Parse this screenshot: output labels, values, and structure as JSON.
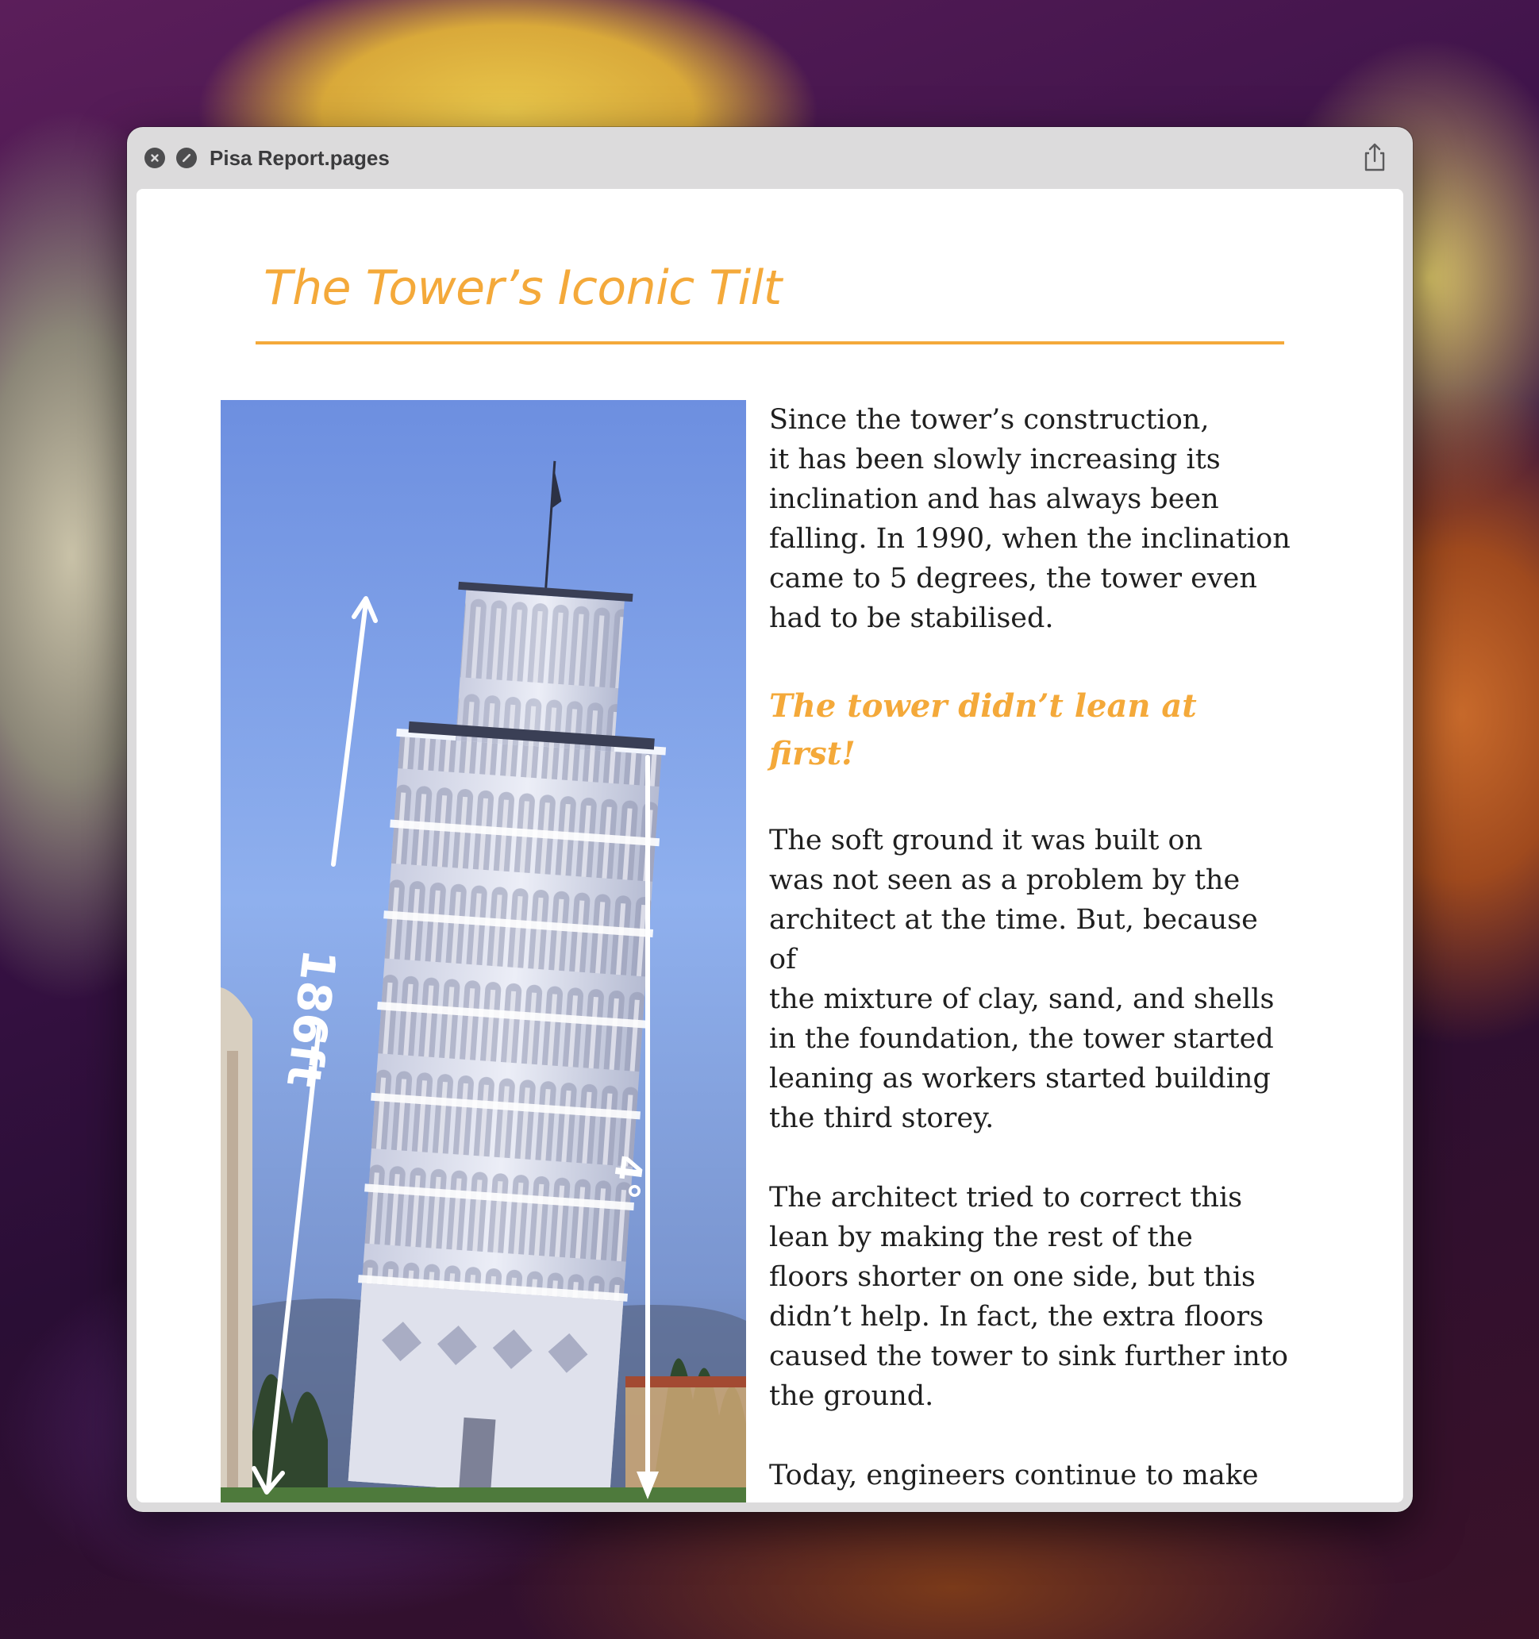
{
  "window": {
    "title": "Pisa Report.pages"
  },
  "document": {
    "heading": "The Tower’s Iconic Tilt",
    "paragraphs": {
      "p1": "Since the tower’s construction,\nit has been slowly increasing its\ninclination and has always been\nfalling. In 1990, when the inclination\ncame to 5 degrees, the tower even\nhad to be stabilised.",
      "subheading": "The tower didn’t lean at first!",
      "p2": "The soft ground it was built on\nwas not seen as a problem by the\narchitect at the time. But, because of\nthe mixture of clay, sand, and shells\nin the foundation, the tower started\nleaning as workers started building\nthe third storey.",
      "p3": "The architect tried to correct this\nlean by making the rest of the\nfloors shorter on one side, but this\ndidn’t help. In fact, the extra floors\ncaused the tower to sink further into\nthe ground.",
      "p4": "Today, engineers continue to make\nsure the centre of gravity still falls\ninside the base. As long as that\nremains true, the tower won’t fall."
    },
    "photo_annotations": {
      "height_label": "186ft",
      "angle_label": "4°"
    }
  },
  "icons": {
    "close": "close-icon",
    "fullscreen": "fullscreen-icon",
    "share": "share-icon"
  },
  "colors": {
    "accent": "#f4a93a",
    "body_text": "#1f1f1f",
    "titlebar": "#dcdbdc"
  }
}
